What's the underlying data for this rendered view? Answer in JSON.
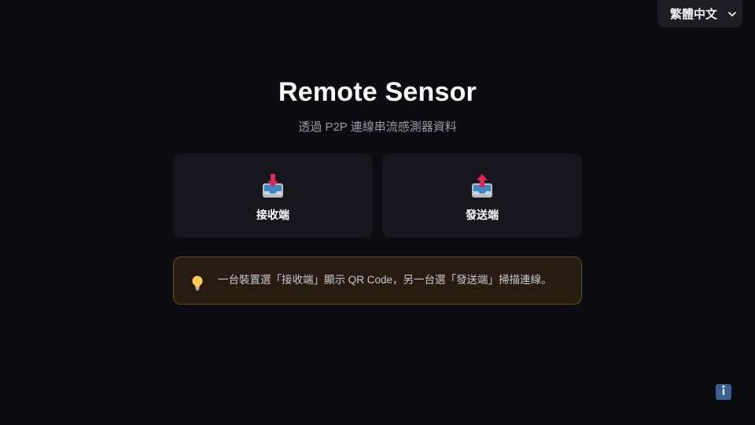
{
  "language_select": {
    "selected": "繁體中文"
  },
  "header": {
    "title": "Remote Sensor",
    "subtitle": "透過 P2P 連線串流感測器資料"
  },
  "modes": [
    {
      "label": "接收端",
      "icon": "inbox-download-icon"
    },
    {
      "label": "發送端",
      "icon": "outbox-upload-icon"
    }
  ],
  "tip": {
    "icon": "lightbulb-icon",
    "text": "一台裝置選「接收端」顯示 QR Code，另一台選「發送端」掃描連線。"
  },
  "info_button": {
    "icon": "info-icon"
  },
  "colors": {
    "background": "#0b0b10",
    "card": "#16161c",
    "tip_background": "#261c12",
    "tip_border": "#6b4a22",
    "arrow_pink": "#e0245e",
    "tray_blue": "#3b88c3",
    "info_blue": "#3b5f8e"
  }
}
